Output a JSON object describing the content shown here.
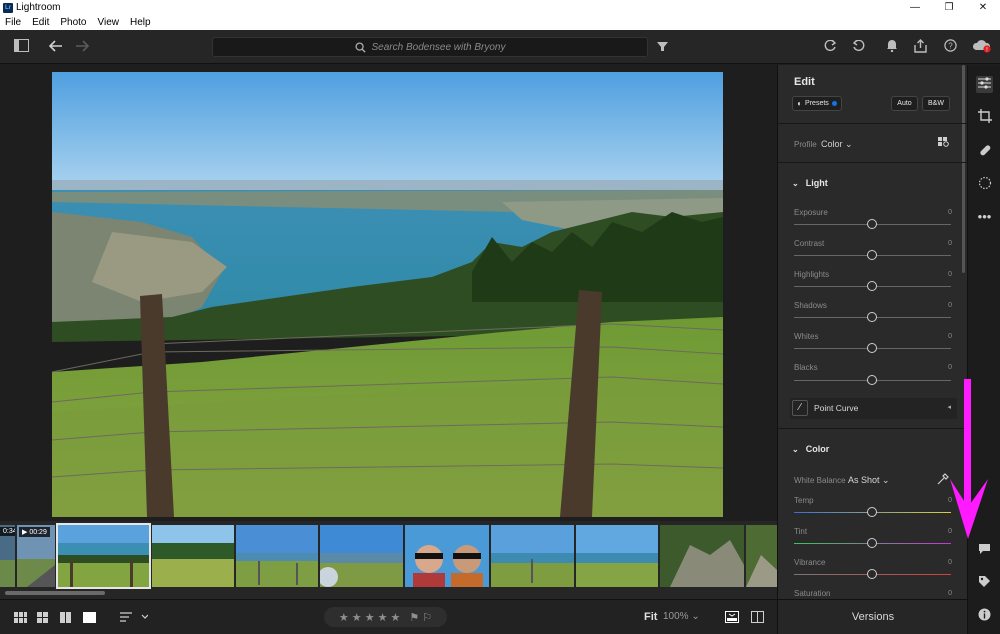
{
  "window": {
    "title": "Lightroom",
    "app_icon": "Lr",
    "controls": [
      "—",
      "❐",
      "✕"
    ]
  },
  "menu": [
    "File",
    "Edit",
    "Photo",
    "View",
    "Help"
  ],
  "toolbar": {
    "search_placeholder": "Search Bodensee with Bryony"
  },
  "filmstrip": {
    "durations": [
      "0:34",
      "▶ 00:29"
    ]
  },
  "bottom": {
    "fit_label": "Fit",
    "zoom_label": "100% ⌄",
    "stars": "★ ★ ★ ★ ★"
  },
  "edit": {
    "title": "Edit",
    "presets_label": "Presets",
    "auto_label": "Auto",
    "bw_label": "B&W",
    "profile_label": "Profile",
    "profile_value": "Color ⌄",
    "light_section": "Light",
    "light_rows": [
      {
        "label": "Exposure",
        "value": "0"
      },
      {
        "label": "Contrast",
        "value": "0"
      },
      {
        "label": "Highlights",
        "value": "0"
      },
      {
        "label": "Shadows",
        "value": "0"
      },
      {
        "label": "Whites",
        "value": "0"
      },
      {
        "label": "Blacks",
        "value": "0"
      }
    ],
    "point_curve_label": "Point Curve",
    "color_section": "Color",
    "white_balance_label": "White Balance",
    "white_balance_value": "As Shot ⌄",
    "color_rows": [
      {
        "label": "Temp",
        "value": "0"
      },
      {
        "label": "Tint",
        "value": "0"
      },
      {
        "label": "Vibrance",
        "value": "0"
      },
      {
        "label": "Saturation",
        "value": "0"
      }
    ]
  },
  "versions_label": "Versions",
  "colors": {
    "accent_blue": "#1473e6",
    "annotation": "#ff1aff",
    "panel": "#2a2a2a"
  }
}
